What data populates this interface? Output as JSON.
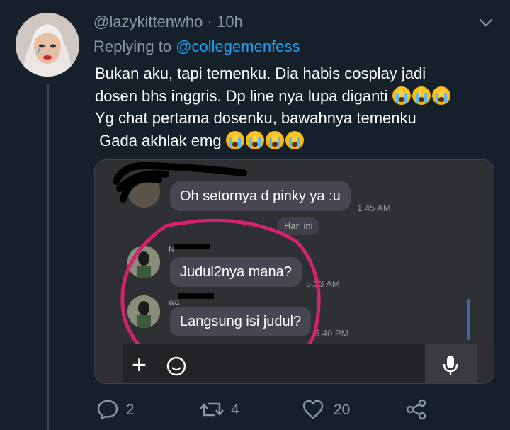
{
  "tweet": {
    "handle": "@lazykittenwho",
    "time": "· 10h",
    "replying_to_label": "Replying to",
    "replying_to": "@collegemenfess",
    "lines": [
      "Bukan aku, tapi temenku. Dia habis cosplay jadi",
      "dosen bhs inggris. Dp line nya lupa diganti",
      "Yg chat pertama dosenku, bawahnya temenku",
      "Gada akhlak emg"
    ],
    "emoji": "loudly-crying-face"
  },
  "chat": {
    "messages": [
      {
        "text": "Oh setornya d pinky ya :u",
        "time": "1.45 AM"
      },
      {
        "text": "Judul2nya mana?",
        "time": "5.33 AM",
        "sender": "N"
      },
      {
        "text": "Langsung isi judul?",
        "time": "5.40 PM",
        "sender": "wa"
      }
    ],
    "date_divider": "Hari ini",
    "icons": [
      "plus-icon",
      "emoji-icon",
      "mic-icon"
    ],
    "highlight_color": "#d3236f"
  },
  "actions": {
    "replies": "2",
    "retweets": "4",
    "likes": "20"
  },
  "colors": {
    "background": "#15202b",
    "secondary_text": "#8899a6",
    "link": "#1da1f2"
  }
}
